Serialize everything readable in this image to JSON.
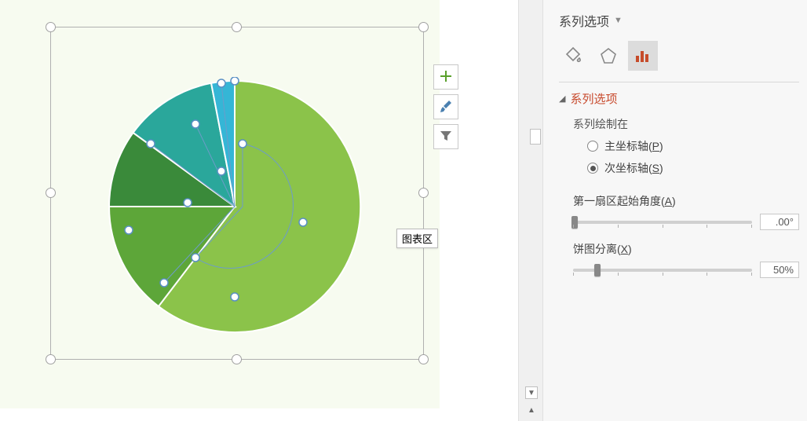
{
  "chart_data": {
    "type": "pie",
    "series": [
      {
        "name": "slice-large-lightgreen",
        "value": 55,
        "color": "#8bc34a"
      },
      {
        "name": "slice-medium-green",
        "value": 20,
        "color": "#5da639"
      },
      {
        "name": "slice-small-darkgreen",
        "value": 10,
        "color": "#3a8a3a"
      },
      {
        "name": "slice-teal",
        "value": 12,
        "color": "#2aa79b"
      },
      {
        "name": "slice-cyan",
        "value": 3,
        "color": "#35b6d6"
      }
    ],
    "first_sector_start_angle": 0,
    "explosion_percent": 50
  },
  "tooltip_text": "图表区",
  "panel": {
    "title": "系列选项",
    "section_title": "系列选项",
    "plot_on_label": "系列绘制在",
    "primary_axis_label": "主坐标轴",
    "primary_axis_accel": "P",
    "secondary_axis_label": "次坐标轴",
    "secondary_axis_accel": "S",
    "axis_selected": "secondary",
    "angle_label": "第一扇区起始角度",
    "angle_accel": "A",
    "angle_value": ".00°",
    "explosion_label": "饼图分离",
    "explosion_accel": "X",
    "explosion_value": "50%"
  },
  "side_buttons": {
    "add": "add-chart-element",
    "styles": "chart-styles",
    "filter": "chart-filters"
  }
}
